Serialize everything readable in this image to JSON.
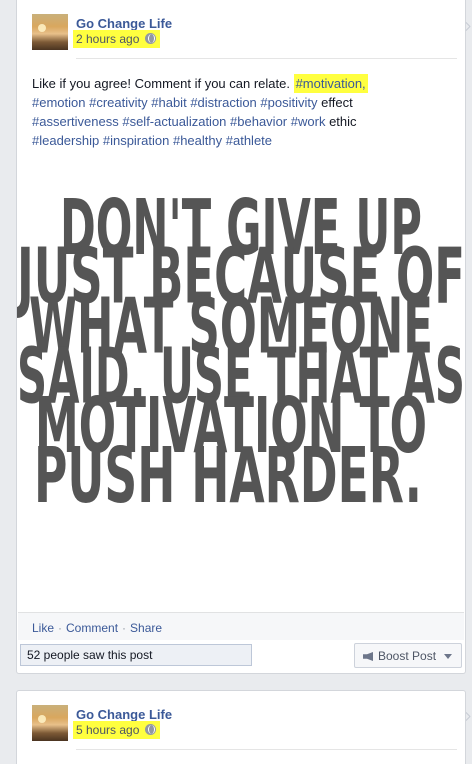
{
  "posts": [
    {
      "page_name": "Go Change Life",
      "timestamp": "2 hours ago",
      "text_intro": "Like if you agree! Comment if you can relate. ",
      "text_hl_tag": "#motivation,",
      "tags": [
        "#emotion",
        "#creativity",
        "#habit",
        "#distraction",
        "#positivity",
        "#assertiveness",
        "#self-actualization",
        "#behavior",
        "#work",
        "#leadership",
        "#inspiration",
        "#healthy",
        "#athlete"
      ],
      "word_effect": "effect",
      "word_ethic": "ethic",
      "quote_lines": [
        "DON'T GIVE UP",
        "JUST BECAUSE OF",
        "WHAT SOMEONE",
        "SAID. USE THAT AS",
        "MOTIVATION TO",
        "PUSH HARDER."
      ],
      "actions": {
        "like": "Like",
        "comment": "Comment",
        "share": "Share"
      },
      "reach_text": "52 people saw this post",
      "boost_label": "Boost Post"
    },
    {
      "page_name": "Go Change Life",
      "timestamp": "5 hours ago"
    }
  ],
  "icons": {
    "privacy": "globe-icon",
    "boost": "megaphone-icon",
    "dropdown": "caret-down-icon"
  },
  "colors": {
    "highlight": "#ffff3f",
    "link": "#3b5998",
    "quote_text": "#555555"
  }
}
